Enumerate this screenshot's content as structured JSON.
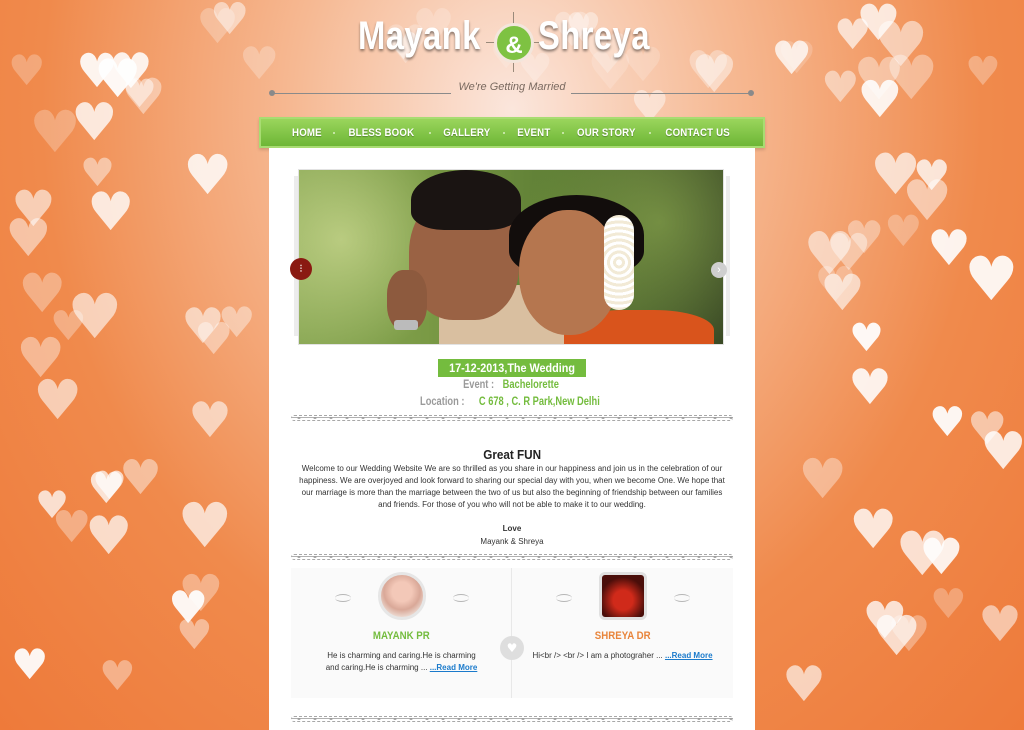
{
  "header": {
    "name_left": "Mayank",
    "amp": "&",
    "name_right": "Shreya",
    "tagline": "We're Getting Married"
  },
  "nav": {
    "items": [
      "HOME",
      "BLESS BOOK",
      "GALLERY",
      "EVENT",
      "OUR STORY",
      "CONTACT US"
    ]
  },
  "slider": {
    "prev_icon": "⁝",
    "next_icon": "›"
  },
  "event": {
    "date_label": "17-12-2013,The Wedding Date",
    "event_label": "Event :",
    "event_value": "Bachelorette",
    "location_label": "Location :",
    "location_value": "C 678 , C. R Park,New Delhi"
  },
  "welcome": {
    "title": "Great FUN",
    "text": "Welcome to our Wedding Website We are so thrilled as you share in our happiness and join us in the celebration of our happiness. We are overjoyed and look forward to sharing our special day with you, when we become One. We hope that our marriage is more than the marriage between the two of us but also the beginning of friendship between our families and friends. For those of you who will not be able to make it to our wedding.",
    "love": "Love",
    "signature": "Mayank & Shreya"
  },
  "profiles": {
    "left": {
      "name": "MAYANK PR",
      "desc": "He is charming and caring.He is charming and caring.He is charming ... ",
      "more": "...Read More"
    },
    "right": {
      "name": "SHREYA DR",
      "desc": "Hi<br /> <br /> I am a photograher ... ",
      "more": "...Read More"
    },
    "heart_icon": "♥"
  },
  "colors": {
    "accent_green": "#74bc3e",
    "accent_orange": "#e8843a",
    "link_blue": "#1a7acb"
  }
}
